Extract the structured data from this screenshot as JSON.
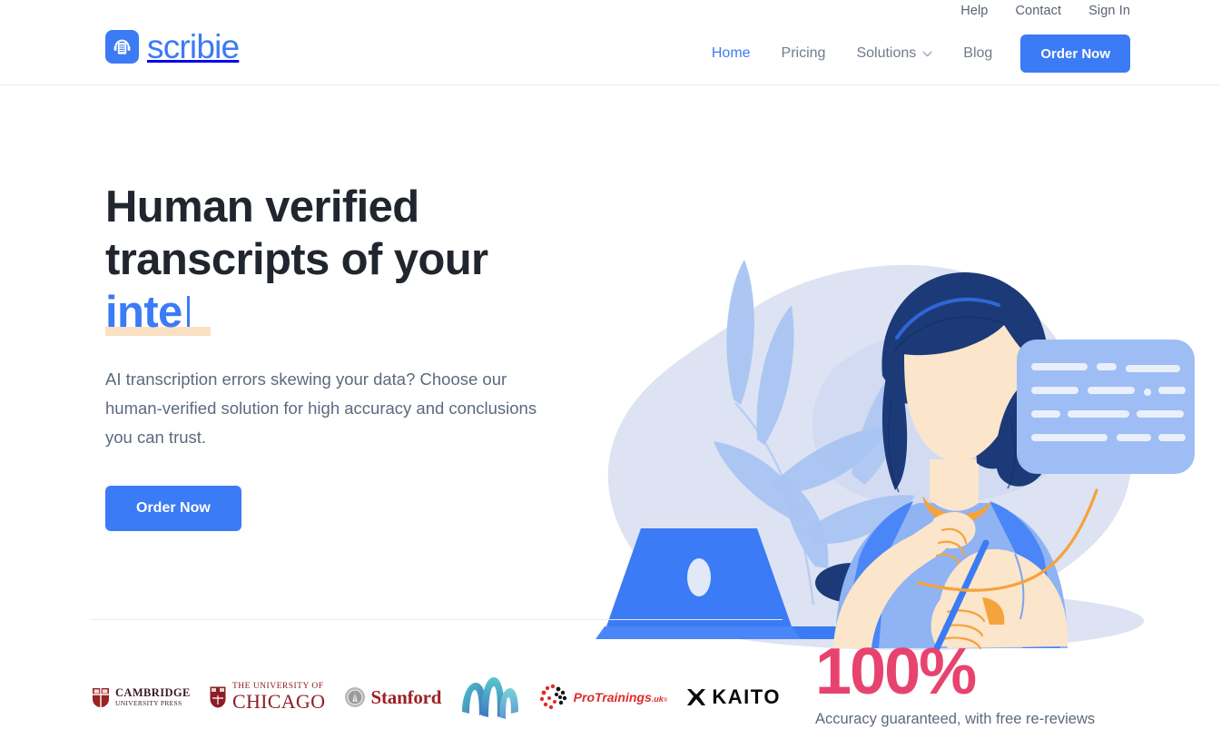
{
  "brand": {
    "name": "scribie",
    "mark_icon": "document-headphones-icon",
    "color": "#3b7bf5"
  },
  "header": {
    "utility_nav": [
      {
        "label": "Help",
        "icon": "help-link"
      },
      {
        "label": "Contact",
        "icon": "contact-link"
      },
      {
        "label": "Sign In",
        "icon": "sign-in-link"
      }
    ],
    "main_nav": [
      {
        "label": "Home",
        "active": true
      },
      {
        "label": "Pricing",
        "active": false
      },
      {
        "label": "Solutions",
        "active": false,
        "has_dropdown": true,
        "dropdown_icon": "chevron-down-icon"
      },
      {
        "label": "Blog",
        "active": false
      }
    ],
    "cta_label": "Order Now"
  },
  "hero": {
    "headline_line1": "Human verified",
    "headline_line2": "transcripts of your",
    "typed_text": "inte",
    "subhead": "AI transcription errors skewing your data? Choose our human-verified solution for high accuracy and conclusions you can trust.",
    "cta_label": "Order Now",
    "illustration": "woman-at-laptop-with-transcript-bubble-illustration",
    "accent_color": "#3b7bf5",
    "highlight_color": "#fae0c3"
  },
  "clients": {
    "logos": [
      {
        "name": "cambridge-university-press-logo",
        "line1": "CAMBRIDGE",
        "line2": "UNIVERSITY PRESS"
      },
      {
        "name": "university-of-chicago-logo",
        "line1": "THE UNIVERSITY OF",
        "line2": "CHICAGO"
      },
      {
        "name": "stanford-logo",
        "line1": "Stanford"
      },
      {
        "name": "wave-logo",
        "line1": ""
      },
      {
        "name": "protrainings-uk-logo",
        "line1": "ProTrainings",
        "line2": ".uk"
      },
      {
        "name": "kaito-logo",
        "line1": "KAITO"
      }
    ]
  },
  "stat": {
    "number": "100%",
    "label": "Accuracy guaranteed, with free re-reviews",
    "color": "#e8436f"
  }
}
